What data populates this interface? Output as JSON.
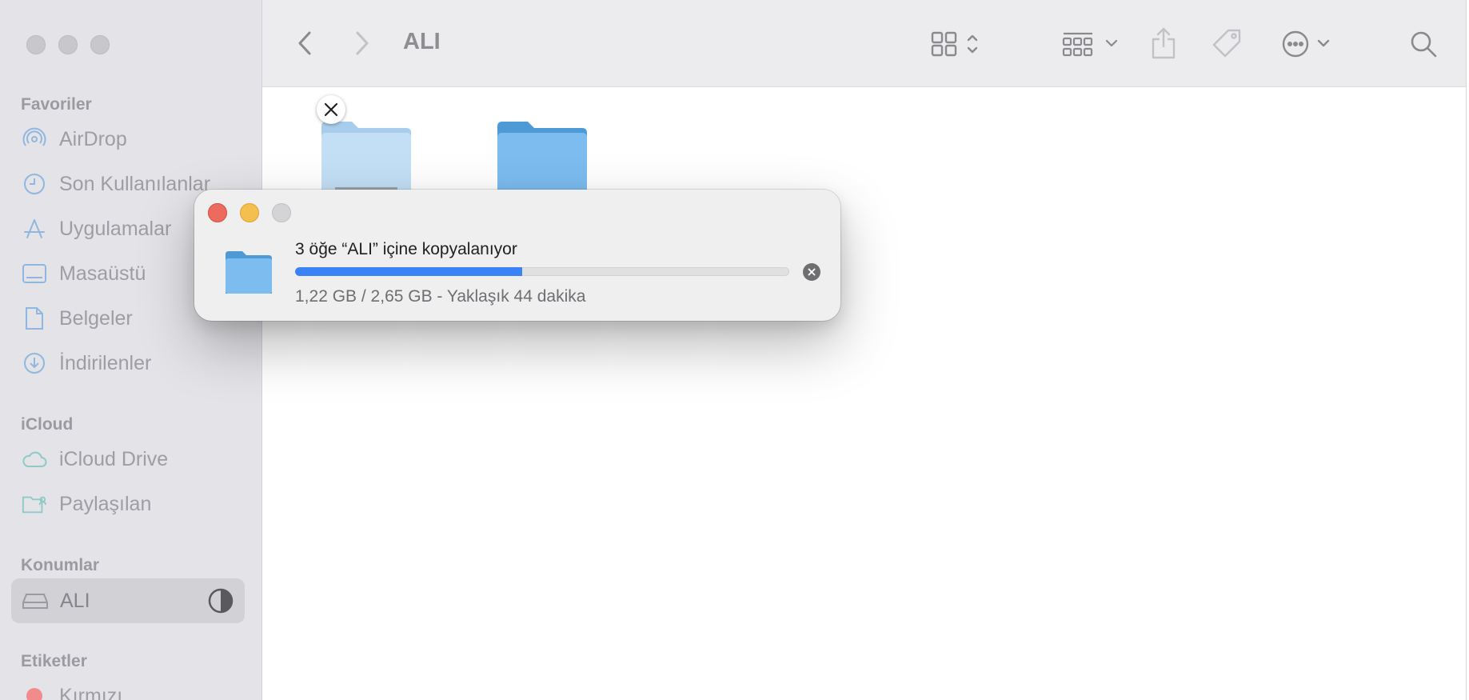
{
  "sidebar": {
    "sections": {
      "favorites": "Favoriler",
      "icloud": "iCloud",
      "locations": "Konumlar",
      "tags": "Etiketler"
    },
    "favorites": [
      {
        "label": "AirDrop",
        "icon": "airdrop-icon"
      },
      {
        "label": "Son Kullanılanlar",
        "icon": "clock-icon"
      },
      {
        "label": "Uygulamalar",
        "icon": "applications-icon"
      },
      {
        "label": "Masaüstü",
        "icon": "desktop-icon"
      },
      {
        "label": "Belgeler",
        "icon": "document-icon"
      },
      {
        "label": "İndirilenler",
        "icon": "download-icon"
      }
    ],
    "icloud": [
      {
        "label": "iCloud Drive",
        "icon": "cloud-icon"
      },
      {
        "label": "Paylaşılan",
        "icon": "shared-folder-icon"
      }
    ],
    "locations": [
      {
        "label": "ALI",
        "icon": "drive-icon",
        "selected": true
      }
    ],
    "tags": [
      {
        "label": "Kırmızı",
        "color": "#f28b8b"
      }
    ]
  },
  "toolbar": {
    "title": "ALI"
  },
  "dialog": {
    "title": "3 öğe “ALI” içine kopyalanıyor",
    "status": "1,22 GB / 2,65 GB - Yaklaşık 44 dakika",
    "progress": 0.46,
    "progress_color": "#3a82f6"
  }
}
